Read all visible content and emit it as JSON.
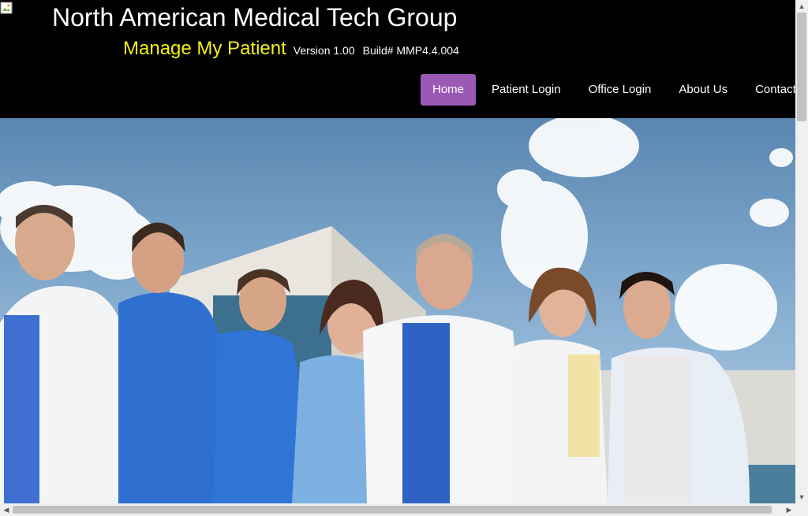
{
  "header": {
    "org_title": "North American Medical Tech Group",
    "app_name": "Manage My Patient",
    "version": "Version 1.00",
    "build": "Build# MMP4.4.004"
  },
  "nav": {
    "items": [
      {
        "label": "Home",
        "active": true
      },
      {
        "label": "Patient Login"
      },
      {
        "label": "Office Login"
      },
      {
        "label": "About Us"
      },
      {
        "label": "Contact Us"
      }
    ]
  },
  "colors": {
    "header_bg": "#000000",
    "accent_active": "#9b59b6",
    "app_name": "#f2ef16",
    "text": "#ffffff"
  },
  "icons": {
    "broken_image": "broken-image-icon",
    "scroll_up": "chevron-up-icon",
    "scroll_down": "chevron-down-icon",
    "scroll_left": "chevron-left-icon",
    "scroll_right": "chevron-right-icon"
  }
}
